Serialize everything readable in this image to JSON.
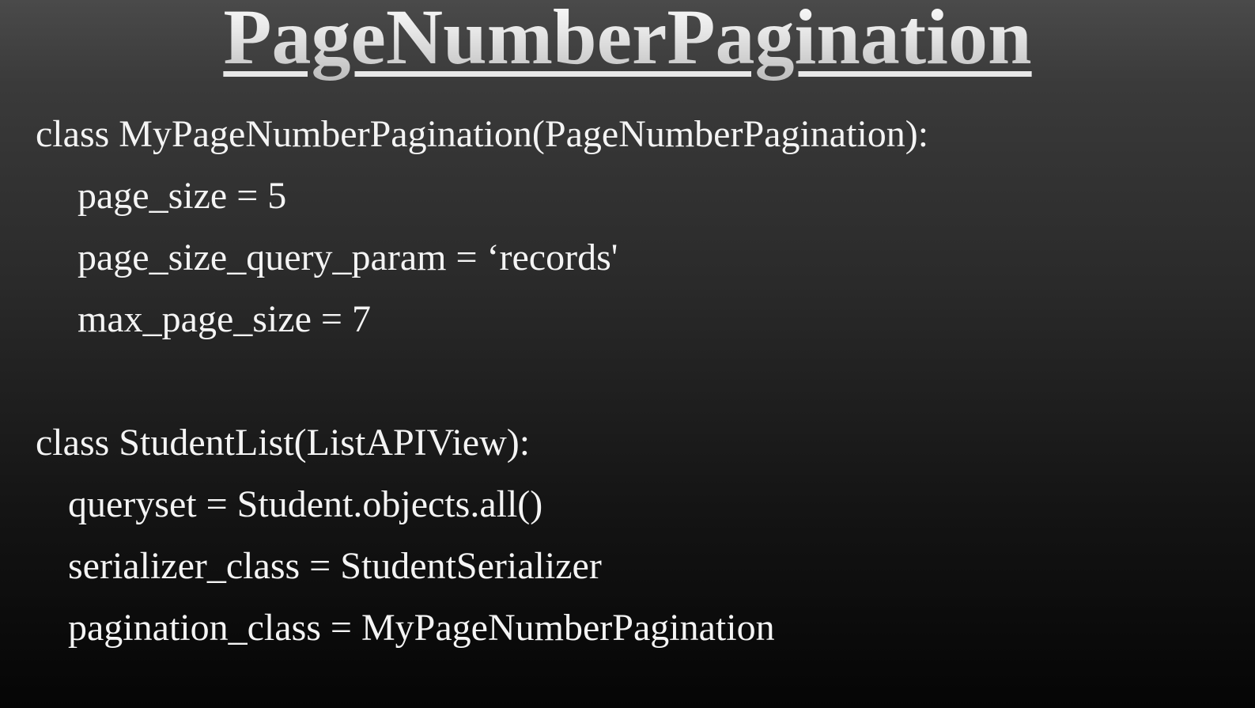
{
  "slide": {
    "title": "PageNumberPagination",
    "code_lines": [
      "class MyPageNumberPagination(PageNumberPagination):",
      "page_size = 5",
      "page_size_query_param = ‘records'",
      "max_page_size = 7",
      "class StudentList(ListAPIView):",
      "queryset = Student.objects.all()",
      "serializer_class = StudentSerializer",
      "pagination_class = MyPageNumberPagination"
    ]
  }
}
